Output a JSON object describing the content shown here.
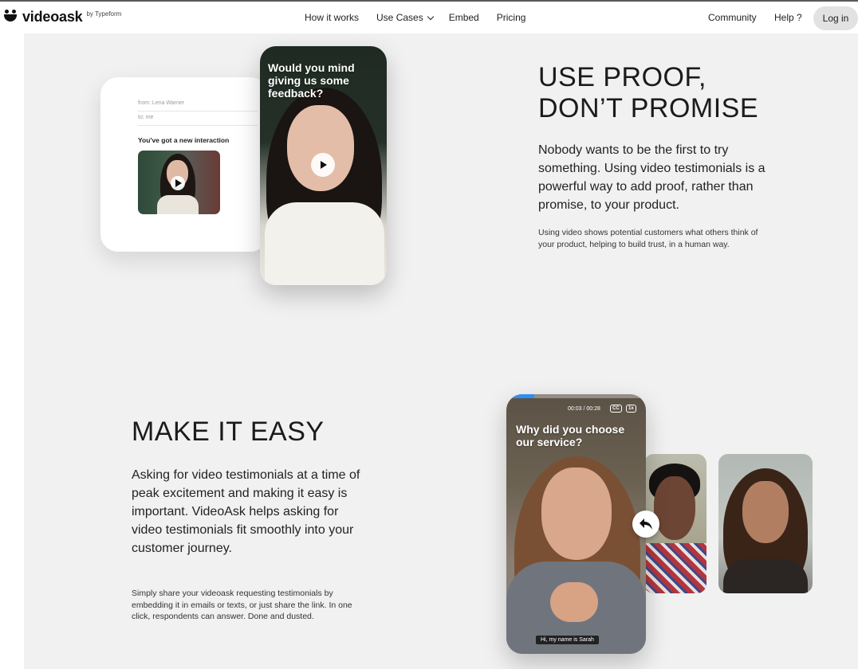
{
  "nav": {
    "logo_text": "videoask",
    "logo_sub": "by Typeform",
    "links": [
      "How it works",
      "Use Cases",
      "Embed",
      "Pricing"
    ],
    "community": "Community",
    "help": "Help ?",
    "login": "Log in"
  },
  "section1": {
    "heading_line1": "USE PROOF,",
    "heading_line2": "DON’T PROMISE",
    "lead": "Nobody wants to be the first to try something. Using video testimonials is a powerful way to add proof, rather than promise, to your product.",
    "small": "Using video shows potential customers what others think of your product, helping to build trust, in a human way.",
    "email": {
      "from": "from: Lena Warner",
      "to": "to: me",
      "title": "You've got a new interaction"
    },
    "phone_question": "Would you mind giving us some feedback?"
  },
  "section2": {
    "heading": "MAKE IT EASY",
    "lead": "Asking for video testimonials at a time of peak excitement and making it easy is important. VideoAsk helps asking for video testimonials fit smoothly into your customer journey.",
    "small": "Simply share your videoask requesting testimonials by embedding it in emails or texts, or just share the link. In one click, respondents can answer. Done and dusted.",
    "phone_question": "Why did you choose our service?",
    "time": "00:03 / 00:28",
    "cc": "CC",
    "speed": "1x",
    "caption": "Hi, my name is Sarah",
    "progress": 0.2
  },
  "icons": {
    "play": "play-icon",
    "reply": "reply-arrow-icon",
    "chevron": "chevron-down-icon"
  },
  "colors": {
    "page_bg": "#f1f1f1",
    "login_bg": "#e2e2e2",
    "progress": "#2e8ef7"
  }
}
